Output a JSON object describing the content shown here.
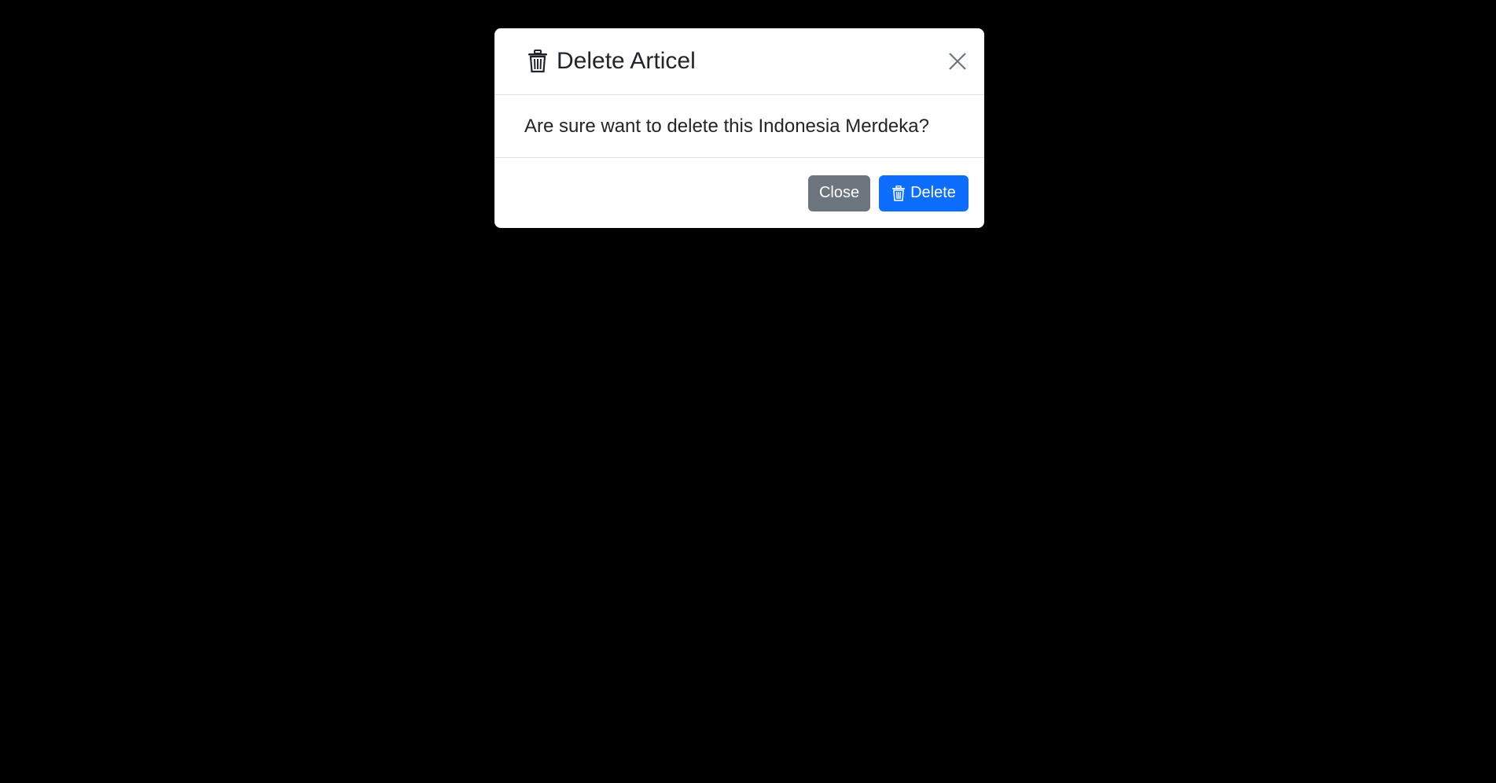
{
  "modal": {
    "title": "Delete Articel",
    "title_icon": "trash-icon",
    "close_icon": "close-icon",
    "message": "Are sure want to delete this Indonesia Merdeka?",
    "buttons": {
      "close_label": "Close",
      "delete_label": "Delete",
      "delete_icon": "trash-icon"
    }
  },
  "colors": {
    "backdrop": "#000000",
    "close_button": "#6c757d",
    "delete_button": "#0d6efd"
  }
}
